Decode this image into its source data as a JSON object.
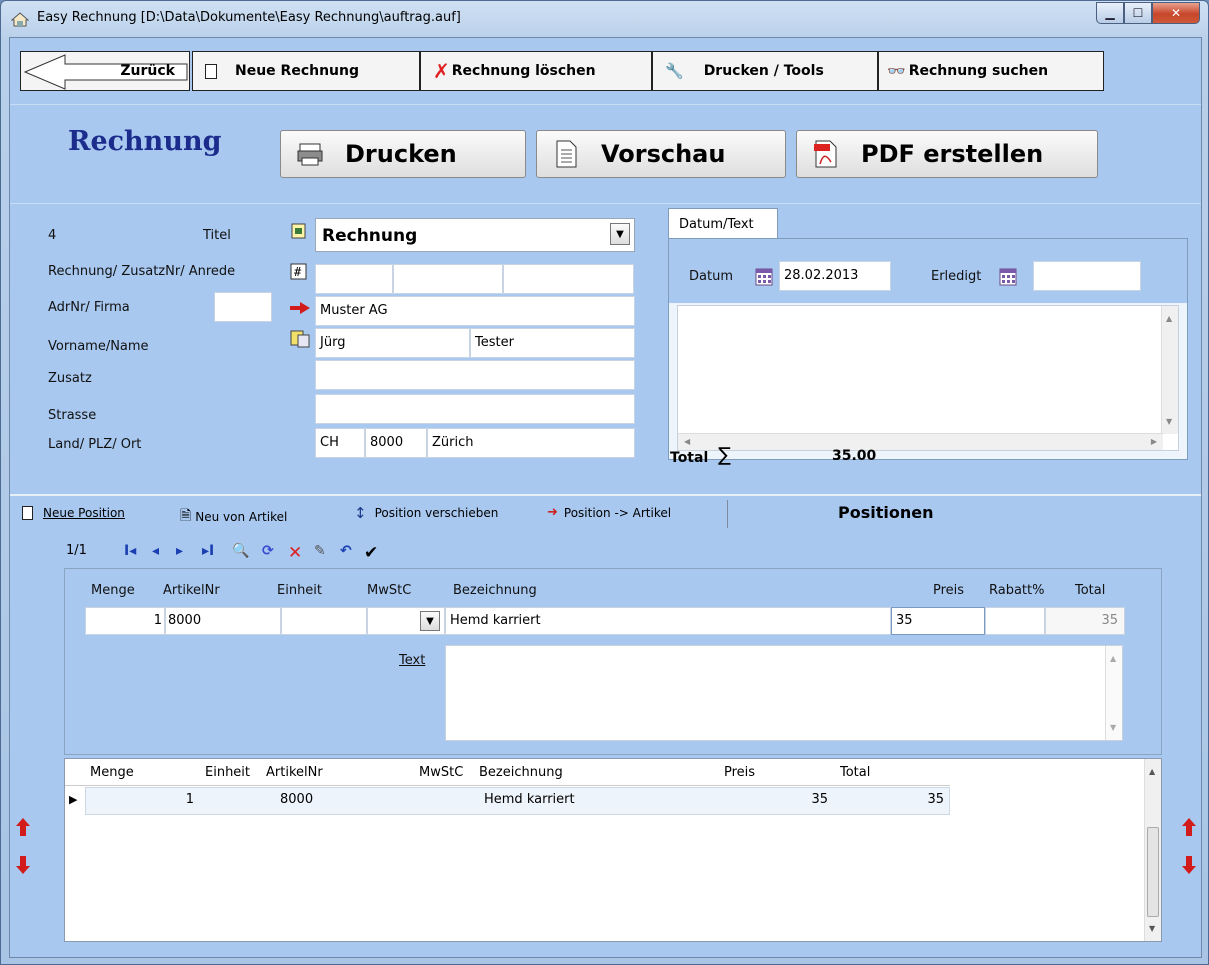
{
  "window": {
    "title": "Easy Rechnung [D:\\Data\\Dokumente\\Easy Rechnung\\auftrag.auf]",
    "min": "▁",
    "max": "☐",
    "close": "✕"
  },
  "toolbar": {
    "back": "Zurück",
    "new": "Neue Rechnung",
    "delete": "Rechnung löschen",
    "print_tools": "Drucken / Tools",
    "search": "Rechnung suchen"
  },
  "header": {
    "title": "Rechnung",
    "print": "Drucken",
    "preview": "Vorschau",
    "pdf": "PDF erstellen"
  },
  "form": {
    "number": "4",
    "labels": {
      "titel": "Titel",
      "rechnung_zusatz": "Rechnung/ ZusatzNr/ Anrede",
      "adrnr": "AdrNr/ Firma",
      "vorname": "Vorname/Name",
      "zusatz": "Zusatz",
      "strasse": "Strasse",
      "land": "Land/ PLZ/ Ort"
    },
    "titel_value": "Rechnung",
    "firma": "Muster AG",
    "vorname": "Jürg",
    "name": "Tester",
    "land": "CH",
    "plz": "8000",
    "ort": "Zürich"
  },
  "datum_tab": {
    "tab_label": "Datum/Text",
    "datum_label": "Datum",
    "datum_value": "28.02.2013",
    "erledigt_label": "Erledigt",
    "total_label": "Total",
    "sigma": "∑",
    "total_value": "35.00"
  },
  "positions_bar": {
    "neue_position": "Neue Position",
    "neu_von_artikel": "Neu von Artikel",
    "verschieben": "Position verschieben",
    "zu_artikel": "Position -> Artikel",
    "title": "Positionen"
  },
  "navigator": {
    "record": "1/1",
    "first": "I◂",
    "prev": "◂",
    "next": "▸",
    "last": "▸I",
    "find": "🔍",
    "refresh": "⟳",
    "delete": "✕",
    "edit": "✎",
    "undo": "↶",
    "confirm": "✔"
  },
  "editor": {
    "headers": {
      "menge": "Menge",
      "artikelnr": "ArtikelNr",
      "einheit": "Einheit",
      "mwstc": "MwStC",
      "bezeichnung": "Bezeichnung",
      "preis": "Preis",
      "rabatt": "Rabatt%",
      "total": "Total"
    },
    "menge": "1",
    "artikelnr": "8000",
    "bezeichnung": "Hemd karriert",
    "preis": "35",
    "total": "35",
    "text_label": "Text"
  },
  "grid": {
    "headers": {
      "menge": "Menge",
      "einheit": "Einheit",
      "artikelnr": "ArtikelNr",
      "mwstc": "MwStC",
      "bezeichnung": "Bezeichnung",
      "preis": "Preis",
      "total": "Total"
    },
    "rows": [
      {
        "menge": "1",
        "einheit": "",
        "artikelnr": "8000",
        "mwstc": "",
        "bezeichnung": "Hemd karriert",
        "preis": "35",
        "total": "35"
      }
    ]
  }
}
